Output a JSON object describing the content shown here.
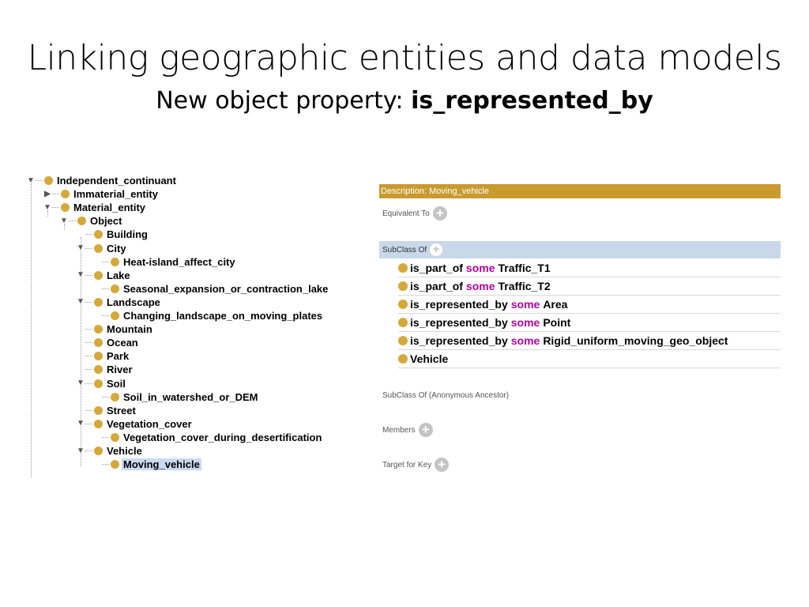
{
  "title": "Linking geographic entities and data models",
  "subtitle_prefix": "New object property:",
  "subtitle_bold": "is_represented_by",
  "tree": [
    {
      "label": "Independent_continuant",
      "toggle": "▼"
    },
    {
      "label": "Immaterial_entity",
      "toggle": "▶"
    },
    {
      "label": "Material_entity",
      "toggle": "▼"
    },
    {
      "label": "Object",
      "toggle": "▼"
    },
    {
      "label": "Building",
      "toggle": ""
    },
    {
      "label": "City",
      "toggle": "▼"
    },
    {
      "label": "Heat-island_affect_city",
      "toggle": ""
    },
    {
      "label": "Lake",
      "toggle": "▼"
    },
    {
      "label": "Seasonal_expansion_or_contraction_lake",
      "toggle": ""
    },
    {
      "label": "Landscape",
      "toggle": "▼"
    },
    {
      "label": "Changing_landscape_on_moving_plates",
      "toggle": ""
    },
    {
      "label": "Mountain",
      "toggle": ""
    },
    {
      "label": "Ocean",
      "toggle": ""
    },
    {
      "label": "Park",
      "toggle": ""
    },
    {
      "label": "River",
      "toggle": ""
    },
    {
      "label": "Soil",
      "toggle": "▼"
    },
    {
      "label": "Soil_in_watershed_or_DEM",
      "toggle": ""
    },
    {
      "label": "Street",
      "toggle": ""
    },
    {
      "label": "Vegetation_cover",
      "toggle": "▼"
    },
    {
      "label": "Vegetation_cover_during_desertification",
      "toggle": ""
    },
    {
      "label": "Vehicle",
      "toggle": "▼"
    },
    {
      "label": "Moving_vehicle",
      "toggle": ""
    }
  ],
  "description": {
    "header": "Description: Moving_vehicle",
    "equivalent_to": "Equivalent To",
    "subclass_of": "SubClass Of",
    "axioms": [
      {
        "property": "is_part_of",
        "keyword": "some",
        "filler": "Traffic_T1"
      },
      {
        "property": "is_part_of",
        "keyword": "some",
        "filler": "Traffic_T2"
      },
      {
        "property": "is_represented_by",
        "keyword": "some",
        "filler": "Area"
      },
      {
        "property": "is_represented_by",
        "keyword": "some",
        "filler": "Point"
      },
      {
        "property": "is_represented_by",
        "keyword": "some",
        "filler": "Rigid_uniform_moving_geo_object"
      },
      {
        "property": "",
        "keyword": "",
        "filler": "Vehicle"
      }
    ],
    "subclass_anon": "SubClass Of (Anonymous Ancestor)",
    "members": "Members",
    "target_for_key": "Target for Key"
  },
  "colors": {
    "class_dot": "#d4a93a",
    "header": "#c99a2e",
    "keyword": "#b5009e",
    "selection": "#c9d9f0"
  }
}
